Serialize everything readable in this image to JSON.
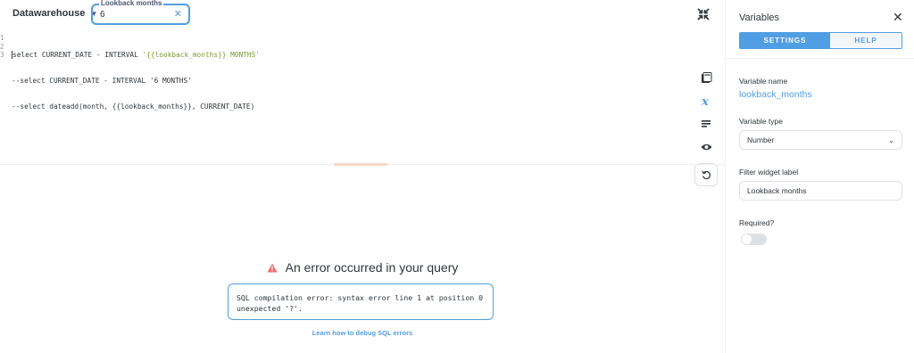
{
  "topbar": {
    "database": "Datawarehouse",
    "variable_widget": {
      "label": "Lookback months",
      "value": "6"
    }
  },
  "editor": {
    "line_numbers": [
      "1",
      "2",
      "3"
    ],
    "lines": [
      {
        "pre": "select CURRENT_DATE - INTERVAL ",
        "str": "'{{lookback_months}} MONTHS'"
      },
      {
        "pre": "--select CURRENT_DATE - INTERVAL '6 MONTHS'",
        "str": ""
      },
      {
        "pre": "--select dateadd(month, {{lookback_months}}, CURRENT_DATE)",
        "str": ""
      }
    ]
  },
  "error": {
    "title": "An error occurred in your query",
    "message": "SQL compilation error: syntax error line 1 at position 0\nunexpected '?'.",
    "link": "Learn how to debug SQL errors"
  },
  "sidebar": {
    "title": "Variables",
    "tabs": [
      "SETTINGS",
      "HELP"
    ],
    "variable_name_label": "Variable name",
    "variable_name": "lookback_months",
    "variable_type_label": "Variable type",
    "variable_type": "Number",
    "widget_label_label": "Filter widget label",
    "widget_label_value": "Lookback months",
    "required_label": "Required?",
    "required": false
  },
  "colors": {
    "accent": "#509ee3",
    "error_icon": "#ed6e6e",
    "string_literal": "#7a9a2c",
    "text": "#2e353b"
  }
}
